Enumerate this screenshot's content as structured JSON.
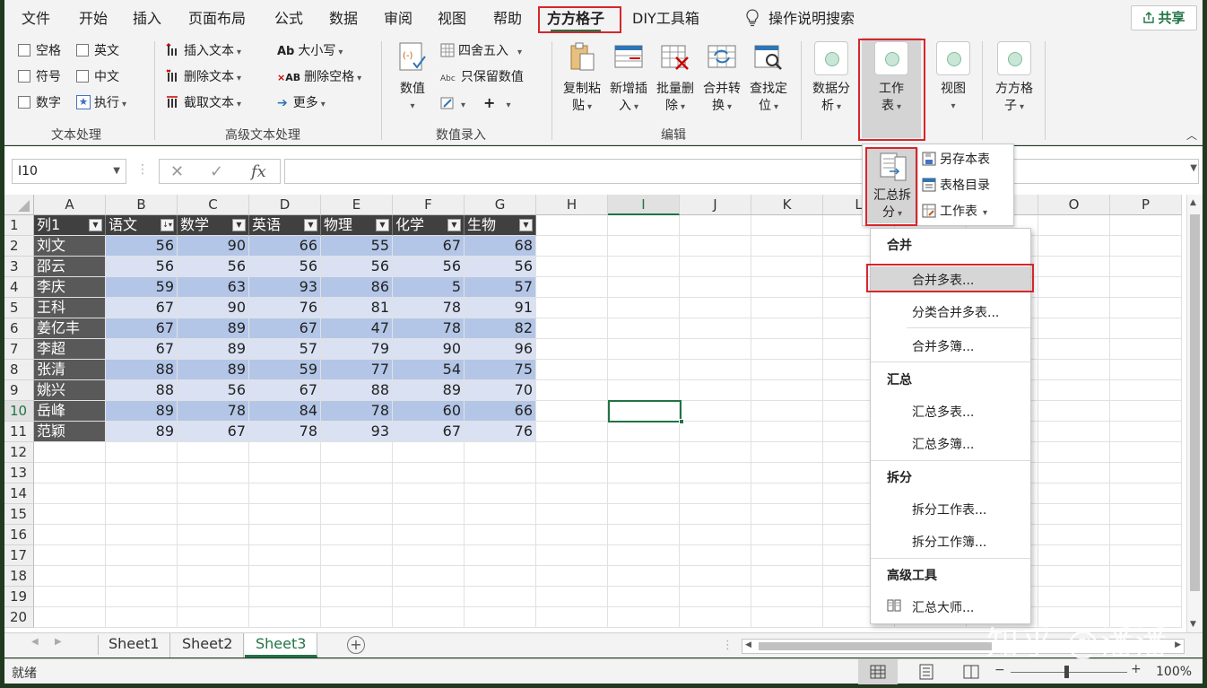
{
  "menu": {
    "tabs": [
      "文件",
      "开始",
      "插入",
      "页面布局",
      "公式",
      "数据",
      "审阅",
      "视图",
      "帮助",
      "方方格子",
      "DIY工具箱"
    ],
    "search": "操作说明搜索",
    "share": "共享"
  },
  "ribbon": {
    "text_group": {
      "label": "文本处理",
      "items": [
        "空格",
        "英文",
        "符号",
        "中文",
        "数字",
        "执行"
      ]
    },
    "adv_text_group": {
      "label": "高级文本处理",
      "items": [
        "插入文本",
        "删除文本",
        "截取文本",
        "大小写",
        "删除空格",
        "更多"
      ]
    },
    "num_group": {
      "label": "数值录入",
      "big": "数值",
      "items": [
        "四舍五入",
        "只保留数值"
      ]
    },
    "edit_group": {
      "label": "编辑",
      "buttons": [
        {
          "l1": "复制粘",
          "l2": "贴"
        },
        {
          "l1": "新增插",
          "l2": "入"
        },
        {
          "l1": "批量删",
          "l2": "除"
        },
        {
          "l1": "合并转",
          "l2": "换"
        },
        {
          "l1": "查找定",
          "l2": "位"
        }
      ]
    },
    "right_buttons": [
      {
        "l1": "数据分",
        "l2": "析"
      },
      {
        "l1": "工作",
        "l2": "表"
      },
      {
        "l1": "视图",
        "l2": ""
      },
      {
        "l1": "方方格",
        "l2": "子"
      }
    ]
  },
  "formula_bar": {
    "name_box": "I10",
    "formula": ""
  },
  "sheet": {
    "columns": [
      "A",
      "B",
      "C",
      "D",
      "E",
      "F",
      "G",
      "H",
      "I",
      "J",
      "K",
      "L",
      "M",
      "N",
      "O",
      "P"
    ],
    "rows": [
      "1",
      "2",
      "3",
      "4",
      "5",
      "6",
      "7",
      "8",
      "9",
      "10",
      "11",
      "12",
      "13",
      "14",
      "15",
      "16",
      "17",
      "18",
      "19",
      "20"
    ],
    "headers": [
      "列1",
      "语文",
      "数学",
      "英语",
      "物理",
      "化学",
      "生物"
    ],
    "data": [
      [
        "刘文",
        "56",
        "90",
        "66",
        "55",
        "67",
        "68"
      ],
      [
        "邵云",
        "56",
        "56",
        "56",
        "56",
        "56",
        "56"
      ],
      [
        "李庆",
        "59",
        "63",
        "93",
        "86",
        "5",
        "57"
      ],
      [
        "王科",
        "67",
        "90",
        "76",
        "81",
        "78",
        "91"
      ],
      [
        "姜亿丰",
        "67",
        "89",
        "67",
        "47",
        "78",
        "82"
      ],
      [
        "李超",
        "67",
        "89",
        "57",
        "79",
        "90",
        "96"
      ],
      [
        "张清",
        "88",
        "89",
        "59",
        "77",
        "54",
        "75"
      ],
      [
        "姚兴",
        "88",
        "56",
        "67",
        "88",
        "89",
        "70"
      ],
      [
        "岳峰",
        "89",
        "78",
        "84",
        "78",
        "60",
        "66"
      ],
      [
        "范颖",
        "89",
        "67",
        "78",
        "93",
        "67",
        "76"
      ]
    ]
  },
  "worksheet_dropdown": {
    "summary_split": {
      "l1": "汇总拆",
      "l2": "分"
    },
    "items": [
      "另存本表",
      "表格目录",
      "工作表"
    ]
  },
  "merge_menu": {
    "sections": [
      {
        "title": "合并",
        "items": [
          "合并多表...",
          "分类合并多表...",
          "合并多簿..."
        ]
      },
      {
        "title": "汇总",
        "items": [
          "汇总多表...",
          "汇总多簿..."
        ]
      },
      {
        "title": "拆分",
        "items": [
          "拆分工作表...",
          "拆分工作簿..."
        ]
      },
      {
        "title": "高级工具",
        "items": [
          "汇总大师..."
        ]
      }
    ]
  },
  "sheet_tabs": [
    "Sheet1",
    "Sheet2",
    "Sheet3"
  ],
  "status": {
    "ready": "就绪",
    "zoom": "100%"
  },
  "watermark": "知乎 @潘潘",
  "colors": {
    "accent": "#217346",
    "highlight_border": "#d6262b",
    "table_band_dark": "#b4c6e7",
    "table_band_light": "#d9e1f2",
    "table_header": "#404040"
  }
}
